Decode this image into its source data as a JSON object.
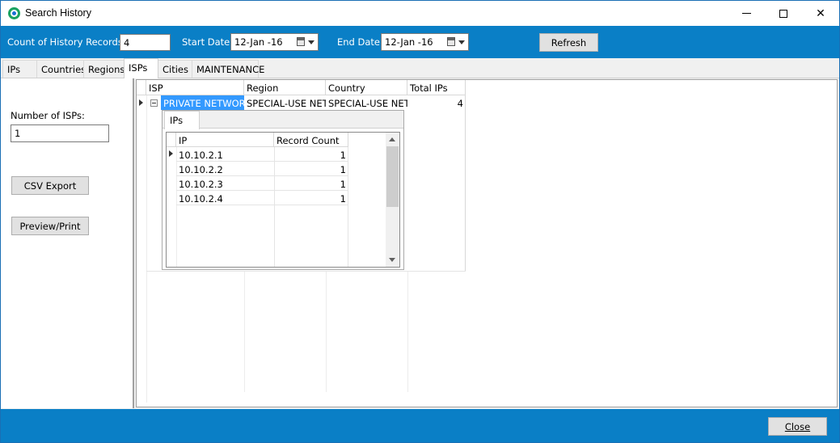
{
  "window": {
    "title": "Search History"
  },
  "toolbar": {
    "count_label": "Count of History Records:",
    "count_value": "4",
    "start_label": "Start Date:",
    "start_value": "12-Jan -16",
    "end_label": "End Date:",
    "end_value": "12-Jan -16",
    "refresh_label": "Refresh"
  },
  "tabs": [
    {
      "label": "IPs"
    },
    {
      "label": "Countries"
    },
    {
      "label": "Regions"
    },
    {
      "label": "ISPs"
    },
    {
      "label": "Cities"
    },
    {
      "label": "MAINTENANCE"
    }
  ],
  "left_panel": {
    "count_label": "Number of ISPs:",
    "count_value": "1",
    "csv_label": "CSV Export",
    "preview_label": "Preview/Print"
  },
  "grid": {
    "columns": [
      "ISP",
      "Region",
      "Country",
      "Total IPs"
    ],
    "rows": [
      {
        "isp": "PRIVATE NETWORKS",
        "region": "SPECIAL-USE NETWORKS",
        "country": "SPECIAL-USE NETWORKS",
        "total": "4"
      }
    ]
  },
  "detail": {
    "tab_label": "IPs",
    "columns": [
      "IP",
      "Record Count"
    ],
    "rows": [
      {
        "ip": "10.10.2.1",
        "count": "1"
      },
      {
        "ip": "10.10.2.2",
        "count": "1"
      },
      {
        "ip": "10.10.2.3",
        "count": "1"
      },
      {
        "ip": "10.10.2.4",
        "count": "1"
      }
    ]
  },
  "footer": {
    "close_label": "Close"
  },
  "colors": {
    "accent": "#0a7fc6",
    "selection": "#3399ff"
  }
}
